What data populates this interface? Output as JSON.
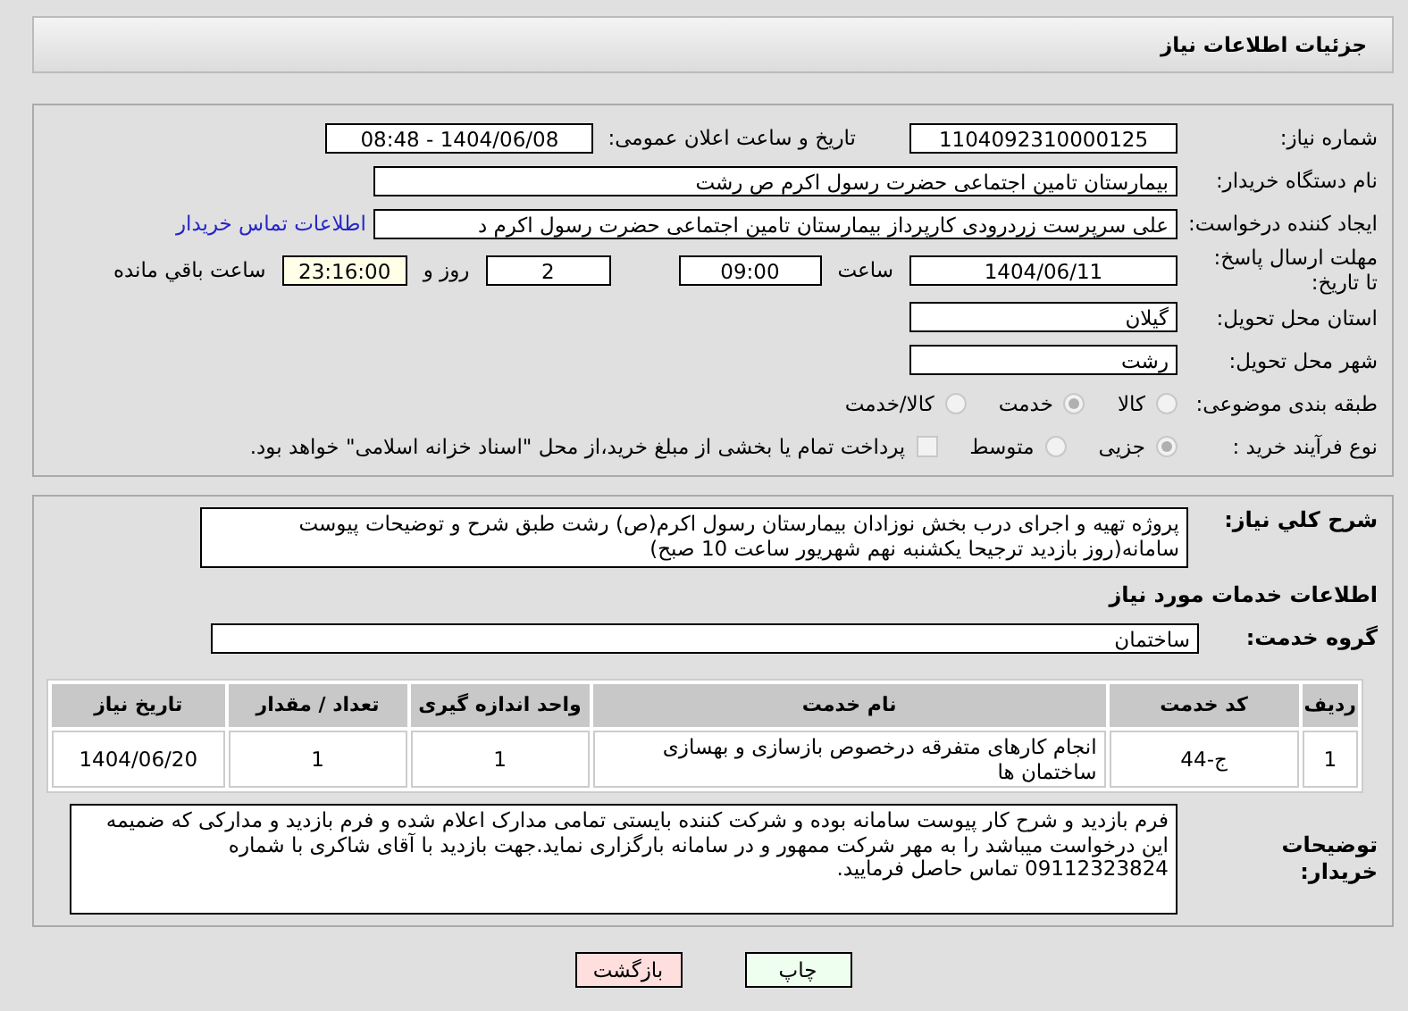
{
  "page_title": "جزئیات اطلاعات نیاز",
  "fields": {
    "need_number": {
      "label": "شماره نیاز:",
      "value": "1104092310000125"
    },
    "announce": {
      "label": "تاریخ و ساعت اعلان عمومی:",
      "value": "1404/06/08 - 08:48"
    },
    "buyer": {
      "label": "نام دستگاه خریدار:",
      "value": "بیمارستان  تامین اجتماعی حضرت رسول اکرم ص رشت"
    },
    "creator": {
      "label": "ایجاد کننده درخواست:",
      "value": "علی سرپرست زردرودی کارپرداز بیمارستان  تامین اجتماعی حضرت رسول اکرم د",
      "link": "اطلاعات تماس خریدار"
    },
    "deadline": {
      "label": "مهلت ارسال پاسخ: تا تاریخ:",
      "date": "1404/06/11",
      "time_label": "ساعت",
      "time": "09:00",
      "days": "2",
      "days_label": "روز و",
      "remaining": "23:16:00",
      "remaining_label": "ساعت باقي مانده"
    },
    "province": {
      "label": "استان محل تحویل:",
      "value": "گیلان"
    },
    "city": {
      "label": "شهر محل تحویل:",
      "value": "رشت"
    }
  },
  "category": {
    "label": "طبقه بندی موضوعی:",
    "options": [
      {
        "label": "کالا",
        "selected": false
      },
      {
        "label": "خدمت",
        "selected": true
      },
      {
        "label": "کالا/خدمت",
        "selected": false
      }
    ]
  },
  "purchase_type": {
    "label": "نوع فرآیند خرید :",
    "options": [
      {
        "label": "جزیی",
        "selected": true
      },
      {
        "label": "متوسط",
        "selected": false
      }
    ],
    "treasury": {
      "label": "پرداخت تمام یا بخشی از مبلغ خرید،از محل \"اسناد خزانه اسلامی\" خواهد بود.",
      "checked": false
    }
  },
  "description": {
    "label": "شرح کلي نياز:",
    "value": "پروژه تهیه و اجرای درب بخش نوزادان بیمارستان رسول اکرم(ص) رشت طبق شرح و توضیحات پیوست سامانه(روز بازدید ترجیحا یکشنبه نهم شهریور ساعت 10 صبح)"
  },
  "services_title": "اطلاعات خدمات مورد نياز",
  "service_group": {
    "label": "گروه خدمت:",
    "value": "ساختمان"
  },
  "table": {
    "columns": [
      "ردیف",
      "کد خدمت",
      "نام خدمت",
      "واحد اندازه گیری",
      "تعداد / مقدار",
      "تاریخ نیاز"
    ],
    "rows": [
      [
        "1",
        "ج-44",
        "انجام کارهای متفرقه درخصوص بازسازی و بهسازی ساختمان ها",
        "1",
        "1",
        "1404/06/20"
      ]
    ]
  },
  "buyer_notes": {
    "label": "توضیحات خریدار:",
    "value": "فرم بازدید و شرح کار پیوست سامانه بوده و شرکت کننده بایستی تمامی مدارک اعلام شده و فرم بازدید و مدارکی که ضمیمه این درخواست میباشد را به مهر شرکت ممهور و در سامانه بارگزاری نماید.جهت بازدید با آقای شاکری با شماره 09112323824 تماس حاصل فرمایید."
  },
  "buttons": [
    {
      "kind": "print",
      "label": "چاپ"
    },
    {
      "kind": "back",
      "label": "بازگشت"
    }
  ]
}
